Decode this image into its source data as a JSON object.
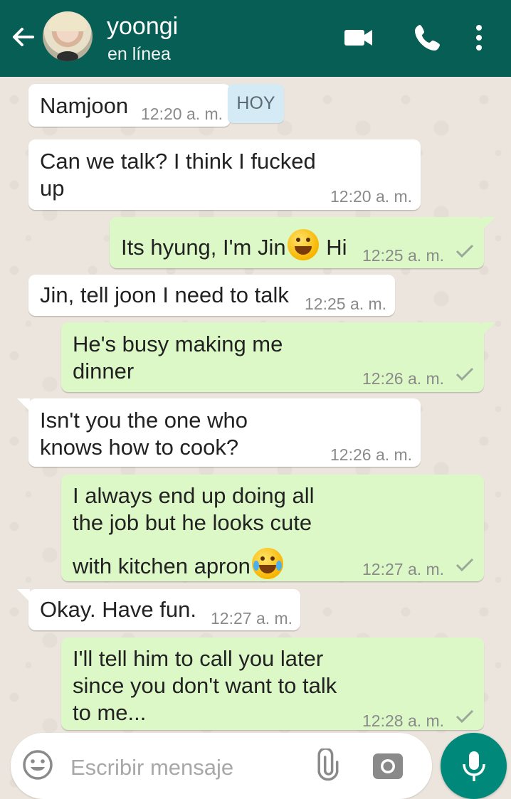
{
  "header": {
    "contact_name": "yoongi",
    "status": "en línea",
    "icons": [
      "back-arrow-icon",
      "video-call-icon",
      "phone-icon",
      "more-options-icon"
    ]
  },
  "date_chip": "HOY",
  "messages": [
    {
      "from": "in",
      "text": "Namjoon",
      "time": "12:20 a. m."
    },
    {
      "from": "in",
      "lines": [
        "Can we talk? I think I fucked",
        "up"
      ],
      "time": "12:20 a. m."
    },
    {
      "from": "out",
      "text_before_emoji": "Its hyung, I'm Jin",
      "emoji": "grinning-face-emoji",
      "text_after_emoji": " Hi",
      "time": "12:25 a. m."
    },
    {
      "from": "in",
      "text": "Jin, tell joon I need to talk",
      "time": "12:25 a. m."
    },
    {
      "from": "out",
      "lines": [
        "He's busy making me",
        "dinner"
      ],
      "time": "12:26 a. m."
    },
    {
      "from": "in",
      "lines": [
        "Isn't you the one who",
        "knows how to cook?"
      ],
      "time": "12:26 a. m."
    },
    {
      "from": "out",
      "lines": [
        "I always end up doing all",
        "the job but he looks cute",
        "with kitchen apron"
      ],
      "emoji": "tears-of-joy-emoji",
      "time": "12:27 a. m."
    },
    {
      "from": "in",
      "text": "Okay. Have fun.",
      "time": "12:27 a. m."
    },
    {
      "from": "out",
      "lines": [
        "I'll tell him to call you later",
        "since you don't want to talk",
        "to me..."
      ],
      "time": "12:28 a. m."
    }
  ],
  "composer": {
    "placeholder": "Escribir mensaje",
    "value": ""
  },
  "colors": {
    "header": "#075e54",
    "outgoing_bubble": "#dcf8c6",
    "incoming_bubble": "#ffffff",
    "mic_button": "#00897b",
    "date_chip": "#d4eaf4"
  }
}
